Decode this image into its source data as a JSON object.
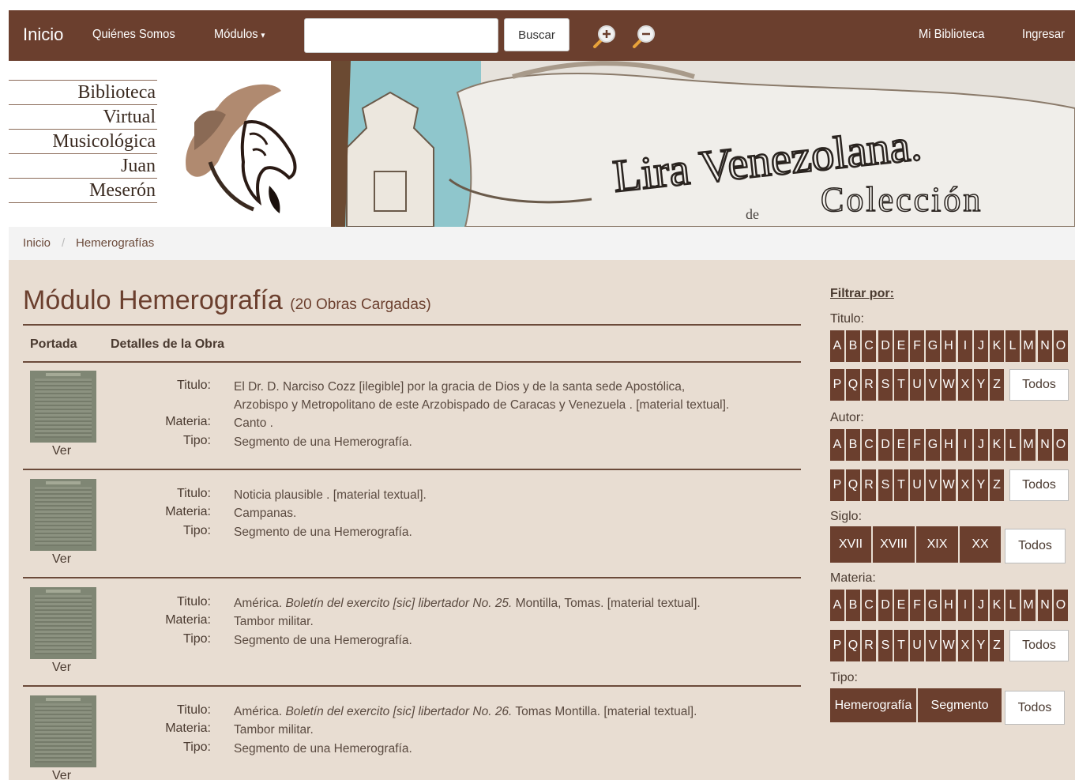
{
  "nav": {
    "brand": "Inicio",
    "quienes": "Quiénes Somos",
    "modulos": "Módulos",
    "search_value": "",
    "search_button": "Buscar",
    "mi_biblioteca": "Mi Biblioteca",
    "ingresar": "Ingresar"
  },
  "logo": {
    "line1": "Biblioteca",
    "line2": "Virtual",
    "line3": "Musicológica",
    "line4": "Juan",
    "line5": "Meserón"
  },
  "banner": {
    "title": "Lira Venezolana.",
    "de": "de",
    "coleccion": "Colección"
  },
  "breadcrumb": {
    "home": "Inicio",
    "sep": "/",
    "current": "Hemerografías"
  },
  "main": {
    "title": "Módulo Hemerografía",
    "count": "(20 Obras Cargadas)",
    "col_portada": "Portada",
    "col_detalles": "Detalles de la Obra",
    "label_titulo": "Titulo:",
    "label_materia": "Materia:",
    "label_tipo": "Tipo:",
    "ver": "Ver",
    "entries": [
      {
        "titulo_a": "El Dr. D. Narciso Cozz [ilegible] por la gracia de Dios y de la santa sede Apostólica,",
        "titulo_b": "Arzobispo y Metropolitano de este Arzobispado de Caracas y Venezuela . [material textual].",
        "materia": "Canto .",
        "tipo": "Segmento de una Hemerografía."
      },
      {
        "titulo_a": "Noticia plausible . [material textual].",
        "materia": "Campanas.",
        "tipo": "Segmento de una Hemerografía."
      },
      {
        "titulo_pre": "América. ",
        "titulo_it": "Boletín del exercito [sic] libertador No. 25.",
        "titulo_post": " Montilla, Tomas. [material textual].",
        "materia": "Tambor militar.",
        "tipo": "Segmento de una Hemerografía."
      },
      {
        "titulo_pre": "América. ",
        "titulo_it": "Boletín del exercito [sic] libertador No. 26.",
        "titulo_post": " Tomas Montilla. [material textual].",
        "materia": "Tambor militar.",
        "tipo": "Segmento de una Hemerografía."
      }
    ]
  },
  "sidebar": {
    "filtrar": "Filtrar por:",
    "titulo": "Titulo:",
    "autor": "Autor:",
    "siglo": "Siglo:",
    "materia": "Materia:",
    "tipo": "Tipo:",
    "todos": "Todos",
    "letters_row1": [
      "A",
      "B",
      "C",
      "D",
      "E",
      "F",
      "G",
      "H",
      "I",
      "J",
      "K",
      "L",
      "M",
      "N",
      "O"
    ],
    "letters_row2": [
      "P",
      "Q",
      "R",
      "S",
      "T",
      "U",
      "V",
      "W",
      "X",
      "Y",
      "Z"
    ],
    "siglos": [
      "XVII",
      "XVIII",
      "XIX",
      "XX"
    ],
    "tipos": [
      "Hemerografía",
      "Segmento"
    ]
  },
  "colors": {
    "primary": "#6b3f2e",
    "background": "#e8ddd2"
  }
}
